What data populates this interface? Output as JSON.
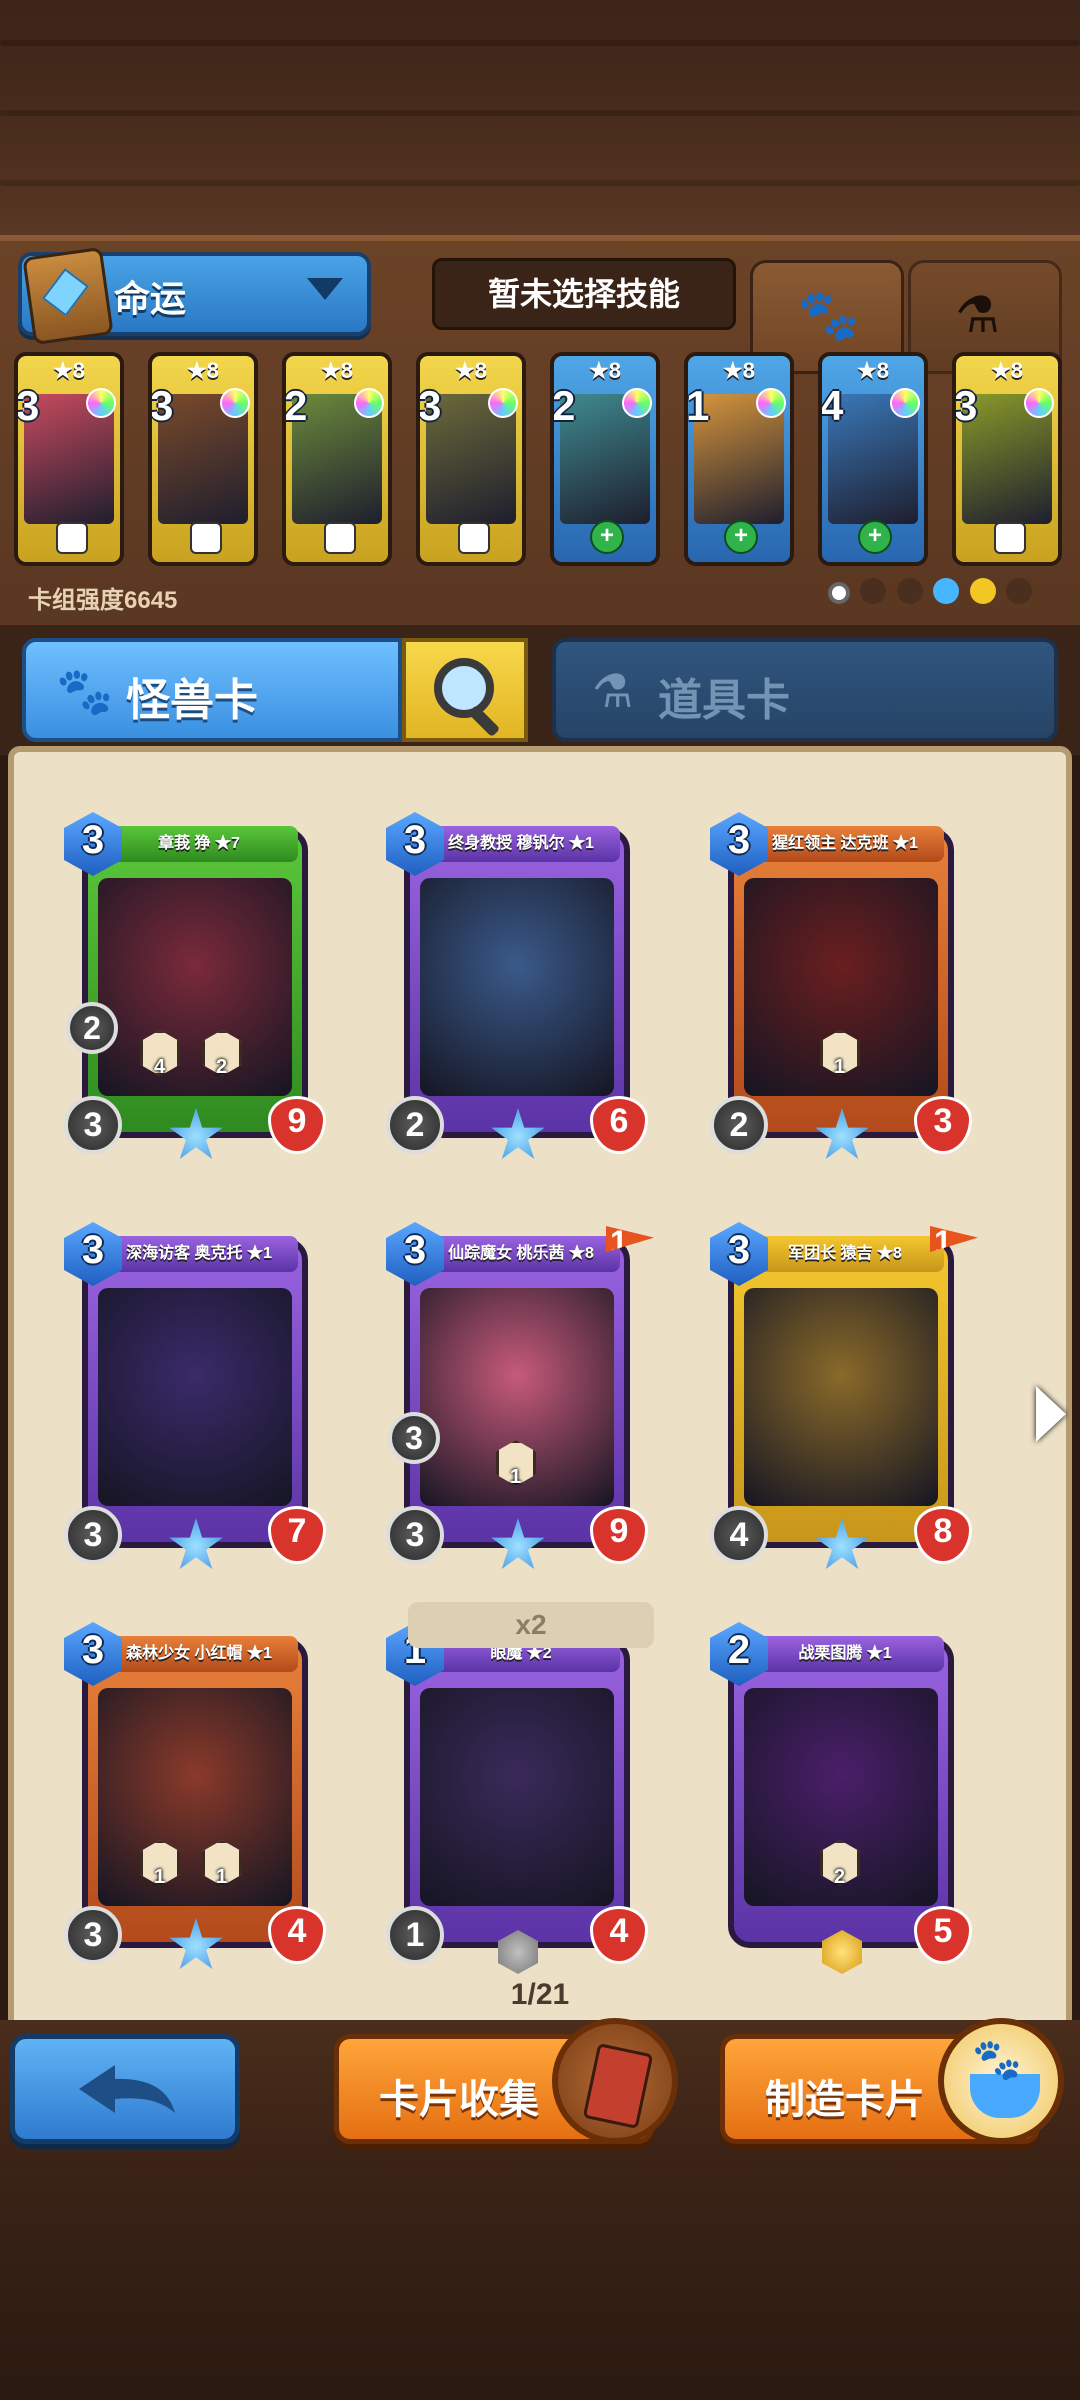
{
  "header": {
    "deck_name": "命运",
    "skill_status": "暂未选择技能",
    "tabs": [
      {
        "icon": "paw-icon"
      },
      {
        "icon": "potion-icon"
      }
    ]
  },
  "deck": {
    "strength": "卡组强度6645",
    "cards": [
      {
        "star": "★8",
        "cost": "3",
        "frame": "gold",
        "art": "#c84a5e"
      },
      {
        "star": "★8",
        "cost": "3",
        "frame": "gold",
        "art": "#7a4a2a"
      },
      {
        "star": "★8",
        "cost": "2",
        "frame": "gold",
        "art": "#6c8a3c"
      },
      {
        "star": "★8",
        "cost": "3",
        "frame": "gold",
        "art": "#6c6a3a"
      },
      {
        "star": "★8",
        "cost": "2",
        "frame": "blue",
        "art": "#3f8a8f"
      },
      {
        "star": "★8",
        "cost": "1",
        "frame": "blue",
        "art": "#d6953c"
      },
      {
        "star": "★8",
        "cost": "4",
        "frame": "blue",
        "art": "#3a78b9"
      },
      {
        "star": "★8",
        "cost": "3",
        "frame": "gold",
        "art": "#8a9a2a"
      }
    ]
  },
  "categories": {
    "monster": "怪兽卡",
    "item": "道具卡"
  },
  "cards": [
    {
      "name": "章莪 狰 ★7",
      "cost": "3",
      "attack": "3",
      "hp": "9",
      "extra": "2",
      "bar": "green",
      "art": "#7a2a3a",
      "skills": [
        "4",
        "2"
      ]
    },
    {
      "name": "终身教授 穆钒尔 ★1",
      "cost": "3",
      "attack": "2",
      "hp": "6",
      "bar": "purple",
      "art": "#3a5a8a",
      "skills": []
    },
    {
      "name": "猩红领主 达克班 ★1",
      "cost": "3",
      "attack": "2",
      "hp": "3",
      "bar": "orange",
      "art": "#6a1f1f",
      "skills": [
        "1"
      ]
    },
    {
      "name": "深海访客 奥克托 ★1",
      "cost": "3",
      "attack": "3",
      "hp": "7",
      "bar": "purple",
      "art": "#3a2a6a",
      "skills": []
    },
    {
      "name": "仙踪魔女 桃乐茜 ★8",
      "cost": "3",
      "attack": "3",
      "hp": "9",
      "extra": "3",
      "bar": "purple",
      "art": "#c75a7a",
      "flag": "1",
      "skills": [
        "1"
      ]
    },
    {
      "name": "军团长 猿吉 ★8",
      "cost": "3",
      "attack": "4",
      "hp": "8",
      "bar": "gold",
      "art": "#8a6a2a",
      "flag": "1",
      "skills": []
    },
    {
      "name": "森林少女 小红帽 ★1",
      "cost": "3",
      "attack": "3",
      "hp": "4",
      "bar": "orange",
      "art": "#8a3a2a",
      "skills": [
        "1",
        "1"
      ]
    },
    {
      "name": "眼魔 ★2",
      "cost": "1",
      "attack": "1",
      "hp": "4",
      "bar": "purple",
      "art": "#3a2a5a",
      "skills": []
    },
    {
      "name": "战栗图腾 ★1",
      "cost": "2",
      "attack": "",
      "hp": "5",
      "bar": "purple",
      "art": "#4a1f6a",
      "skills": [
        "2"
      ]
    }
  ],
  "duplicate": "x2",
  "page": "1/21",
  "bottom": {
    "collect": "卡片收集",
    "craft": "制造卡片"
  }
}
